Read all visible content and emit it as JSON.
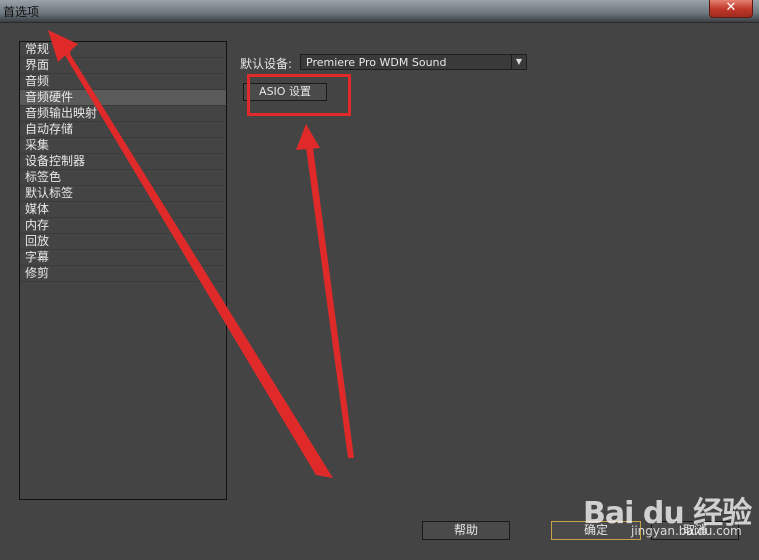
{
  "window": {
    "title": "首选项",
    "close_label": "✕"
  },
  "sidebar": {
    "items": [
      {
        "label": "常规"
      },
      {
        "label": "界面"
      },
      {
        "label": "音频"
      },
      {
        "label": "音频硬件",
        "selected": true
      },
      {
        "label": "音频输出映射"
      },
      {
        "label": "自动存储"
      },
      {
        "label": "采集"
      },
      {
        "label": "设备控制器"
      },
      {
        "label": "标签色"
      },
      {
        "label": "默认标签"
      },
      {
        "label": "媒体"
      },
      {
        "label": "内存"
      },
      {
        "label": "回放"
      },
      {
        "label": "字幕"
      },
      {
        "label": "修剪"
      }
    ]
  },
  "audio_hardware": {
    "device_label": "默认设备:",
    "device_value": "Premiere Pro WDM Sound",
    "asio_button_label": "ASIO 设置"
  },
  "footer": {
    "help_label": "帮助",
    "ok_label": "确定",
    "cancel_label": "取消"
  },
  "watermark": {
    "logo_text": "Bai du 经验",
    "sub_text": "jingyan.baidu.com"
  },
  "colors": {
    "annotation_red": "#e02a2a",
    "panel_bg": "#444444"
  }
}
